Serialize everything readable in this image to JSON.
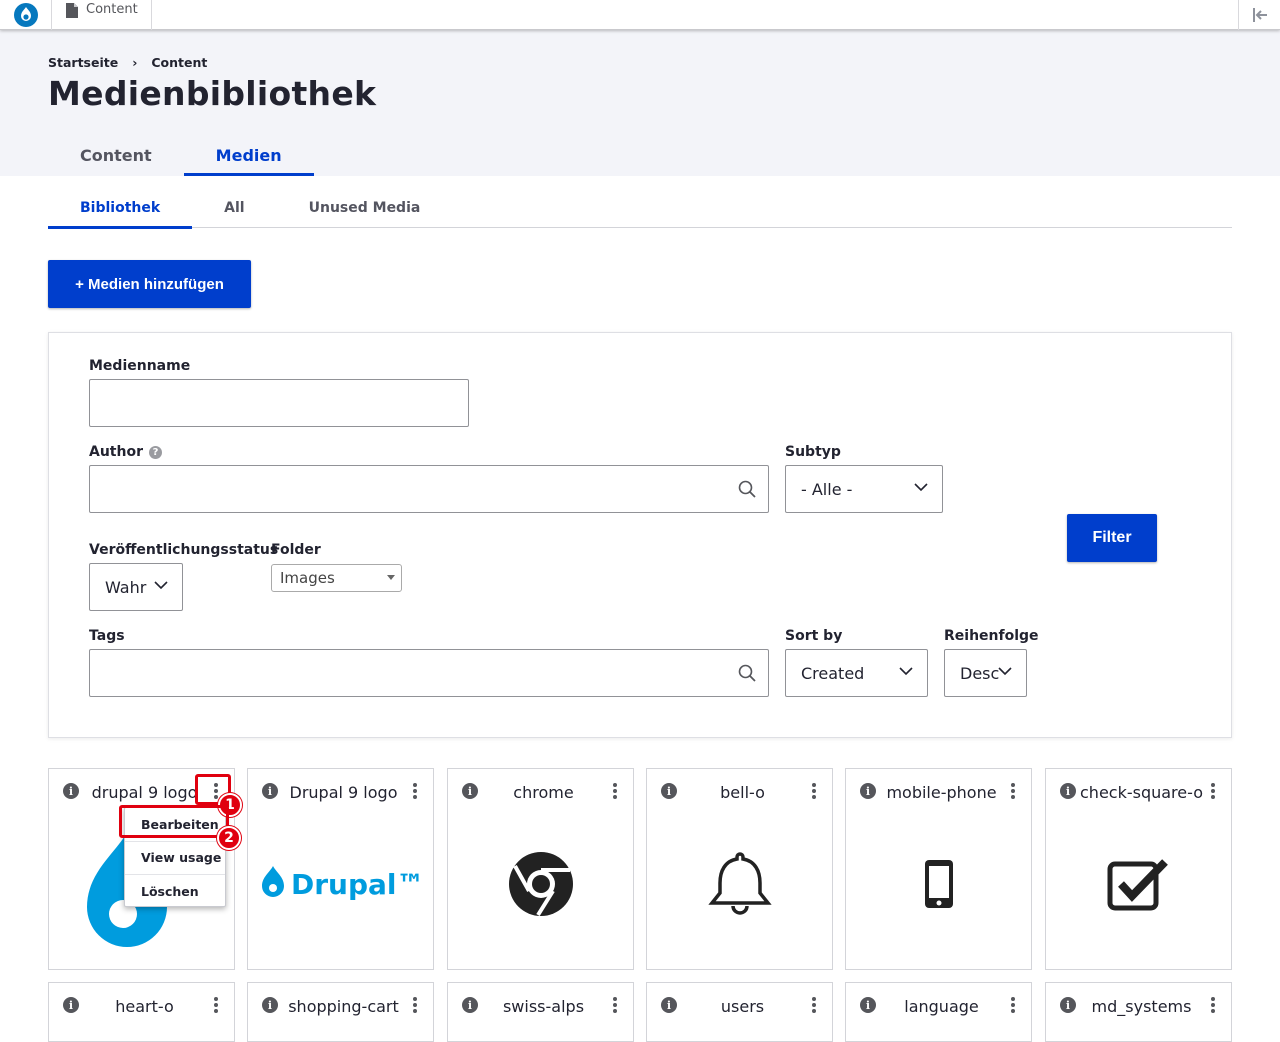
{
  "toolbar": {
    "content_label": "Content"
  },
  "breadcrumb": {
    "home": "Startseite",
    "separator": "›",
    "current": "Content"
  },
  "page_title": "Medienbibliothek",
  "primary_tabs": [
    {
      "label": "Content",
      "active": false
    },
    {
      "label": "Medien",
      "active": true
    }
  ],
  "secondary_tabs": [
    {
      "label": "Bibliothek",
      "active": true
    },
    {
      "label": "All",
      "active": false
    },
    {
      "label": "Unused Media",
      "active": false
    }
  ],
  "add_media_button": "+ Medien hinzufügen",
  "filters": {
    "medienname_label": "Medienname",
    "medienname_value": "",
    "author_label": "Author",
    "author_help": "?",
    "author_value": "",
    "subtyp_label": "Subtyp",
    "subtyp_value": "- Alle -",
    "status_label": "Veröffentlichungsstatus",
    "status_value": "Wahr",
    "folder_label": "Folder",
    "folder_value": "Images",
    "tags_label": "Tags",
    "tags_value": "",
    "sortby_label": "Sort by",
    "sortby_value": "Created",
    "order_label": "Reihenfolge",
    "order_value": "Desc",
    "filter_button": "Filter"
  },
  "cards": [
    {
      "name": "drupal 9 logo",
      "thumbnail": "drupal-drop-logo"
    },
    {
      "name": "Drupal 9 logo",
      "thumbnail": "drupal-wordmark-logo"
    },
    {
      "name": "chrome",
      "thumbnail": "chrome-icon"
    },
    {
      "name": "bell-o",
      "thumbnail": "bell-icon"
    },
    {
      "name": "mobile-phone",
      "thumbnail": "mobile-phone-icon"
    },
    {
      "name": "check-square-o",
      "thumbnail": "check-square-icon"
    }
  ],
  "cards_row2": [
    {
      "name": "heart-o"
    },
    {
      "name": "shopping-cart"
    },
    {
      "name": "swiss-alps"
    },
    {
      "name": "users"
    },
    {
      "name": "language"
    },
    {
      "name": "md_systems"
    }
  ],
  "card_menu": {
    "edit": "Bearbeiten",
    "usage": "View usage",
    "delete": "Löschen"
  },
  "annotations": {
    "step1": "1",
    "step2": "2",
    "color": "#e0000f"
  },
  "colors": {
    "accent": "#003ecc",
    "drupal_blue": "#009cde"
  },
  "drupal_wordmark": "Drupal™"
}
